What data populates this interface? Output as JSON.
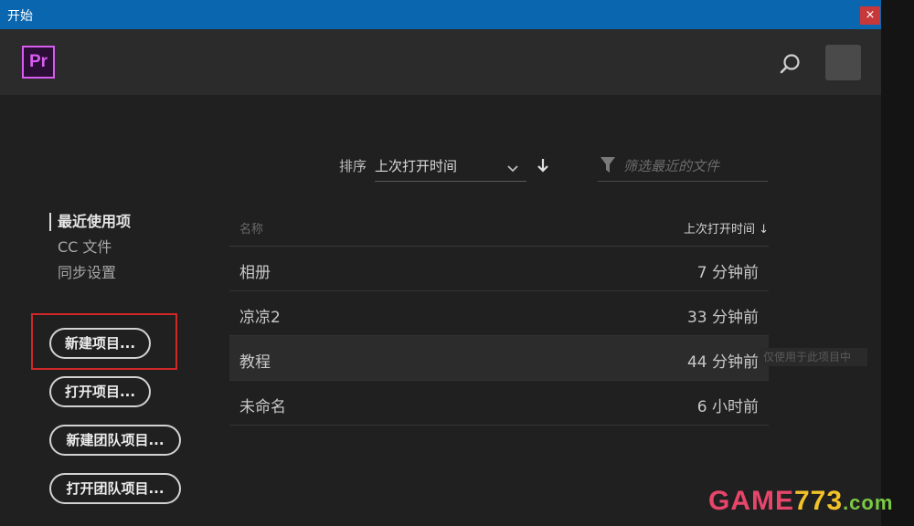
{
  "window": {
    "title": "开始",
    "close_glyph": "×"
  },
  "header": {
    "app_logo": "Pr"
  },
  "sort": {
    "label": "排序",
    "value": "上次打开时间"
  },
  "filter": {
    "placeholder": "筛选最近的文件"
  },
  "nav": {
    "items": [
      {
        "label": "最近使用项",
        "active": true
      },
      {
        "label": "CC 文件",
        "active": false
      },
      {
        "label": "同步设置",
        "active": false
      }
    ]
  },
  "buttons": {
    "new_project": "新建项目...",
    "open_project": "打开项目...",
    "new_team_project": "新建团队项目...",
    "open_team_project": "打开团队项目..."
  },
  "table": {
    "col_name": "名称",
    "col_time": "上次打开时间 ↓",
    "rows": [
      {
        "name": "相册",
        "time": "7 分钟前"
      },
      {
        "name": "凉凉2",
        "time": "33 分钟前"
      },
      {
        "name": "教程",
        "time": "44 分钟前"
      },
      {
        "name": "未命名",
        "time": "6 小时前"
      }
    ]
  },
  "tooltip": "仅使用于此项目中",
  "watermark": {
    "part1": "GAME",
    "part2": "773",
    "part3": ".com"
  },
  "colors": {
    "titlebar": "#0b66b0",
    "pr_accent": "#d95cf0",
    "highlight": "#d02828"
  }
}
